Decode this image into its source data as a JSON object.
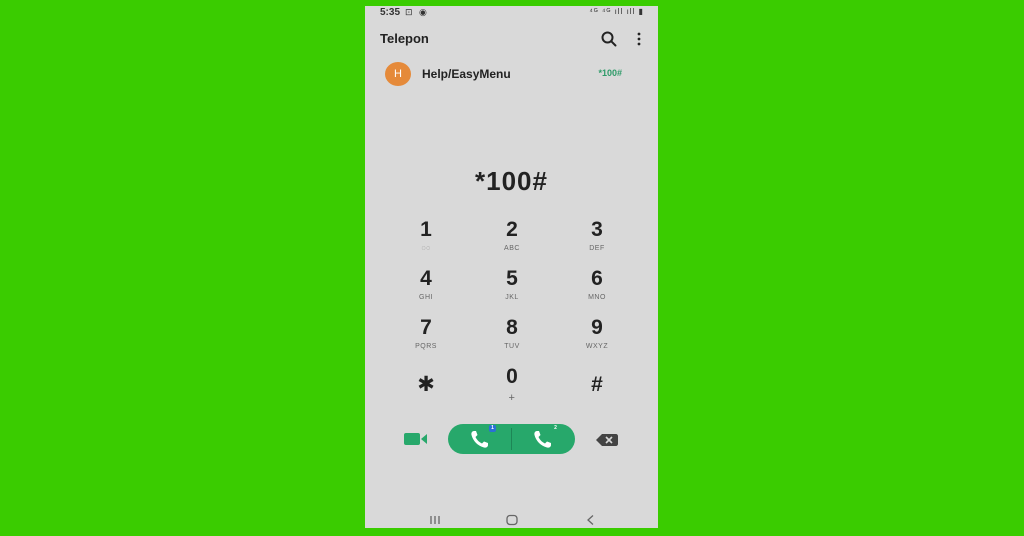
{
  "status_bar": {
    "time": "5:35",
    "left_icons": "⊡ ◉",
    "right_icons": "⁴ᴳ ⁴ᴳ ıll ıll ▮"
  },
  "app_bar": {
    "title": "Telepon",
    "icons": [
      "search-icon",
      "more-options-icon"
    ]
  },
  "suggestion": {
    "avatar_letter": "H",
    "name": "Help/EasyMenu",
    "number": "*100#"
  },
  "dialed_number": "*100#",
  "keypad": [
    {
      "digit": "1",
      "letters": "◌◌"
    },
    {
      "digit": "2",
      "letters": "ABC"
    },
    {
      "digit": "3",
      "letters": "DEF"
    },
    {
      "digit": "4",
      "letters": "GHI"
    },
    {
      "digit": "5",
      "letters": "JKL"
    },
    {
      "digit": "6",
      "letters": "MNO"
    },
    {
      "digit": "7",
      "letters": "PQRS"
    },
    {
      "digit": "8",
      "letters": "TUV"
    },
    {
      "digit": "9",
      "letters": "WXYZ"
    },
    {
      "digit": "✱",
      "letters": ""
    },
    {
      "digit": "0",
      "letters": "+"
    },
    {
      "digit": "#",
      "letters": ""
    }
  ],
  "call_actions": {
    "sim1_badge": "1",
    "sim2_badge": "2",
    "icons": [
      "video-call-icon",
      "phone-sim1-icon",
      "phone-sim2-icon",
      "backspace-icon"
    ]
  },
  "colors": {
    "background": "#3acc00",
    "screen": "#d9d9d9",
    "accent": "#27a86b",
    "avatar": "#e58a3a"
  }
}
